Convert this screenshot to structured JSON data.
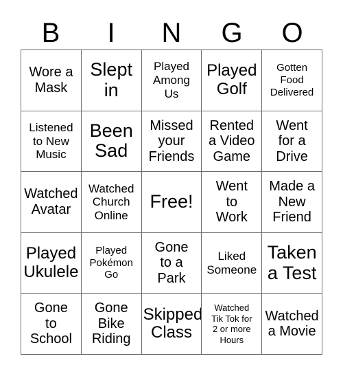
{
  "card": {
    "title_letters": [
      "B",
      "I",
      "N",
      "G",
      "O"
    ],
    "columns": 5,
    "rows": 5,
    "free_space_label": "Free!",
    "free_space_position": {
      "row": 3,
      "column": 3
    },
    "border_color": "#6b6b6b",
    "text_color": "#000000",
    "background_color": "#ffffff",
    "cells": [
      {
        "text": "Wore a\nMask",
        "size": "lg"
      },
      {
        "text": "Slept\nin",
        "size": "xxl"
      },
      {
        "text": "Played\nAmong\nUs",
        "size": "md"
      },
      {
        "text": "Played\nGolf",
        "size": "xl"
      },
      {
        "text": "Gotten\nFood\nDelivered",
        "size": "sm"
      },
      {
        "text": "Listened\nto New\nMusic",
        "size": "md"
      },
      {
        "text": "Been\nSad",
        "size": "xxl"
      },
      {
        "text": "Missed\nyour\nFriends",
        "size": "lg"
      },
      {
        "text": "Rented\na Video\nGame",
        "size": "lg"
      },
      {
        "text": "Went\nfor a\nDrive",
        "size": "lg"
      },
      {
        "text": "Watched\nAvatar",
        "size": "lg"
      },
      {
        "text": "Watched\nChurch\nOnline",
        "size": "md"
      },
      {
        "text": "Free!",
        "size": "xxl"
      },
      {
        "text": "Went\nto\nWork",
        "size": "lg"
      },
      {
        "text": "Made a\nNew\nFriend",
        "size": "lg"
      },
      {
        "text": "Played\nUkulele",
        "size": "xl"
      },
      {
        "text": "Played\nPokémon\nGo",
        "size": "sm"
      },
      {
        "text": "Gone\nto a\nPark",
        "size": "lg"
      },
      {
        "text": "Liked\nSomeone",
        "size": "md"
      },
      {
        "text": "Taken\na Test",
        "size": "xxl"
      },
      {
        "text": "Gone\nto\nSchool",
        "size": "lg"
      },
      {
        "text": "Gone\nBike\nRiding",
        "size": "lg"
      },
      {
        "text": "Skipped\nClass",
        "size": "xl"
      },
      {
        "text": "Watched\nTik Tok for\n2 or more\nHours",
        "size": "xs"
      },
      {
        "text": "Watched\na Movie",
        "size": "lg"
      }
    ]
  }
}
